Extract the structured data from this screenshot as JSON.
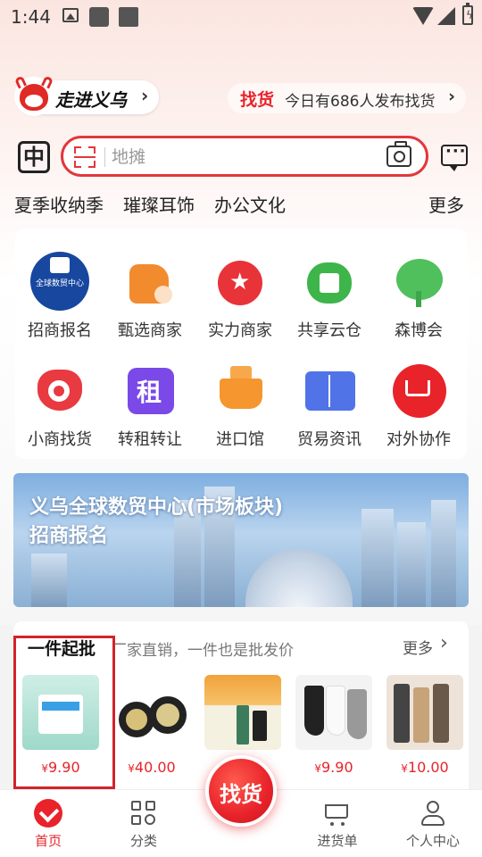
{
  "status_bar": {
    "time": "1:44"
  },
  "intro": {
    "label": "走进义乌",
    "arrow": "›"
  },
  "find_banner": {
    "tag": "找货",
    "text": "今日有686人发布找货",
    "arrow": "›"
  },
  "search": {
    "lang_icon": "中",
    "placeholder": "地摊"
  },
  "hot_tags": [
    "夏季收纳季",
    "璀璨耳饰",
    "办公文化"
  ],
  "hot_more": "更多",
  "grid": [
    {
      "label": "招商报名",
      "icon": "global-trade-center-logo-icon",
      "logo_text": "全球数贸中心"
    },
    {
      "label": "甄选商家",
      "icon": "thumbs-up-icon"
    },
    {
      "label": "实力商家",
      "icon": "star-medal-icon"
    },
    {
      "label": "共享云仓",
      "icon": "cloud-warehouse-icon"
    },
    {
      "label": "森博会",
      "icon": "tree-hand-icon"
    },
    {
      "label": "小商找货",
      "icon": "bull-search-icon"
    },
    {
      "label": "转租转让",
      "icon": "rent-icon",
      "glyph": "租"
    },
    {
      "label": "进口馆",
      "icon": "ship-icon"
    },
    {
      "label": "贸易资讯",
      "icon": "open-book-icon"
    },
    {
      "label": "对外协作",
      "icon": "globe-cart-icon"
    }
  ],
  "banner": {
    "title": "义乌全球数贸中心(市场板块)",
    "subtitle": "招商报名"
  },
  "products_section": {
    "title": "一件起批",
    "subtitle": "厂家直销，一件也是批发价",
    "more": "更多",
    "items": [
      {
        "currency": "¥",
        "price": "9.90"
      },
      {
        "currency": "¥",
        "price": "40.00"
      },
      {
        "currency": "¥",
        "price": ""
      },
      {
        "currency": "¥",
        "price": "9.90"
      },
      {
        "currency": "¥",
        "price": "10.00"
      }
    ]
  },
  "bottom_nav": {
    "items": [
      {
        "label": "首页",
        "active": true
      },
      {
        "label": "分类"
      },
      {
        "label": "进货单"
      },
      {
        "label": "个人中心"
      }
    ],
    "center_button": "找货"
  },
  "colors": {
    "accent": "#e8232a",
    "brand_blue": "#17479e"
  }
}
